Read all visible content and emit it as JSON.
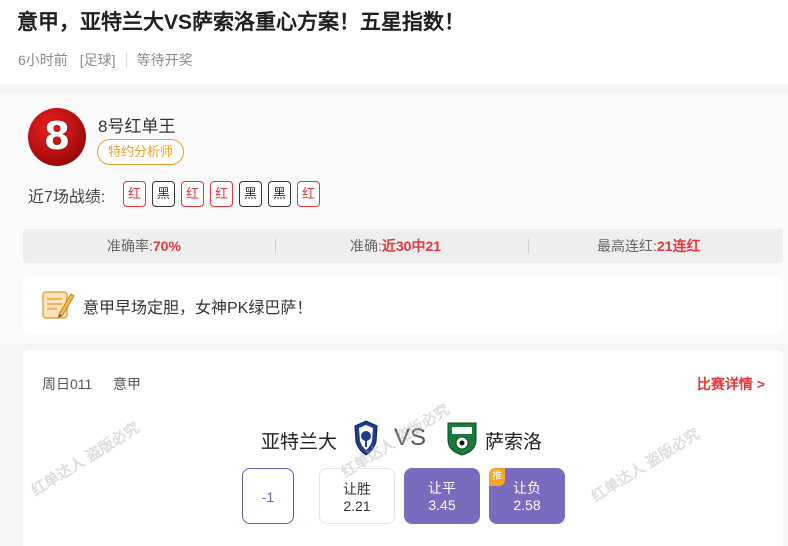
{
  "article": {
    "title": "意甲，亚特兰大VS萨索洛重心方案！五星指数！",
    "time": "6小时前",
    "category": "[足球]",
    "status": "等待开奖"
  },
  "author": {
    "name": "8号红单王",
    "badge": "特约分析师",
    "avatar_number": "8",
    "record_label": "近7场战绩:",
    "record": [
      "红",
      "黑",
      "红",
      "红",
      "黑",
      "黑",
      "红"
    ]
  },
  "stats": {
    "accuracy_label": "准确率:",
    "accuracy_value": "70%",
    "recent_label": "准确:",
    "recent_value": "近30中21",
    "streak_label": "最高连红:",
    "streak_value": "21连红"
  },
  "note": {
    "text": "意甲早场定胆，女神PK绿巴萨！"
  },
  "match": {
    "date": "周日011",
    "league": "意甲",
    "detail_link": "比赛详情 >",
    "home_team": "亚特兰大",
    "vs": "VS",
    "away_team": "萨索洛",
    "handicap": "-1",
    "options": {
      "win_label": "让胜",
      "win_odds": "2.21",
      "draw_label": "让平",
      "draw_odds": "3.45",
      "lose_label": "让负",
      "lose_odds": "2.58",
      "recommend_tag": "推"
    }
  },
  "watermark": "红单达人 盗版必究",
  "colors": {
    "accent_red": "#e0383e",
    "badge_orange": "#f0a028",
    "pick_purple": "#7b6bbf"
  }
}
